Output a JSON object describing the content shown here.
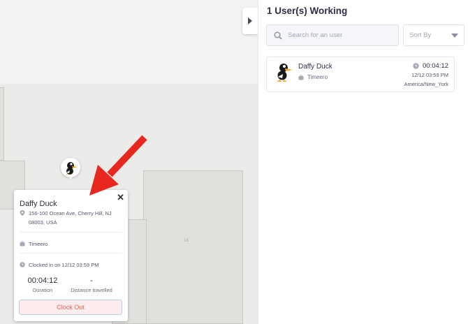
{
  "panel": {
    "title": "1 User(s) Working",
    "search_placeholder": "Search for an user",
    "sort_label": "Sort By"
  },
  "users": [
    {
      "name": "Daffy Duck",
      "organization": "Timeero",
      "duration": "00:04:12",
      "clock_in_time": "12/12 03:59 PM",
      "timezone": "America/New_York"
    }
  ],
  "popup": {
    "close_symbol": "✕",
    "name": "Daffy Duck",
    "address": "156-100 Ocean Ave, Cherry Hill, NJ 08003, USA",
    "organization": "Timeero",
    "clocked_in": "Clocked in on 12/12 03:59 PM",
    "duration_value": "00:04:12",
    "duration_label": "Duration",
    "distance_value": "-",
    "distance_label": "Distance travelled",
    "clock_out_label": "Clock Out"
  },
  "map": {
    "building_label": "18"
  },
  "colors": {
    "accent_red": "#e0605c",
    "annotation_arrow": "#e8281e",
    "clock_out_bg": "#fdecec",
    "clock_out_border": "#b9cbe2",
    "map_bg": "#ebebe9"
  },
  "icons": {
    "collapse": "chevron-right-icon",
    "search": "search-icon",
    "sort": "caret-down-icon",
    "location": "map-pin-icon",
    "organization": "briefcase-icon",
    "clock": "clock-icon",
    "close": "close-icon"
  }
}
